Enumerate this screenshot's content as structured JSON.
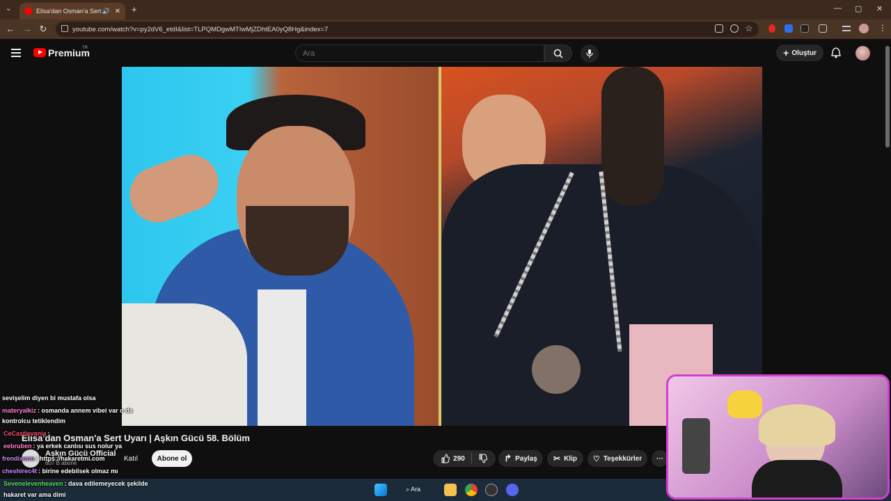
{
  "browser": {
    "tab_title": "Elisa'dan Osman'a Sert Uya",
    "url": "youtube.com/watch?v=py2dV6_etdI&list=TLPQMDgwMTIwMjZDhtEA0yQ8Hg&index=7",
    "back": "←",
    "forward": "→",
    "reload": "↻",
    "new_tab": "+",
    "minimize": "—",
    "maximize": "▢",
    "close": "✕",
    "tab_close": "✕",
    "tab_list": "⌄"
  },
  "youtube": {
    "premium_label": "Premium",
    "region": "TR",
    "search_placeholder": "Ara",
    "create_label": "Oluştur"
  },
  "video": {
    "title": "Elisa'dan Osman'a Sert Uyarı | Aşkın Gücü 58. Bölüm",
    "channel_name": "Aşkın Gücü Official",
    "channel_subs": "807 B abone",
    "join_label": "Katıl",
    "subscribe_label": "Abone ol",
    "like_count": "290",
    "share_label": "Paylaş",
    "clip_label": "Klip",
    "thanks_label": "Teşekkürler",
    "more_label": "···"
  },
  "chat": [
    {
      "user": "",
      "text": "sevişelim diyen bi mustafa olsa",
      "color": "#ffffff"
    },
    {
      "user": "materyalkiz",
      "text": ": osmanda annem vibei var o da",
      "color": "#ff7fd0"
    },
    {
      "user": "",
      "text": "kontrolcu tetiklendim",
      "color": "#ffffff"
    },
    {
      "user": "CeCastlevania",
      "text": ":",
      "color": "#ff4b6e"
    },
    {
      "user": "eebruben",
      "text": ": ya erkek canlısı sus nolur ya",
      "color": "#ff7fd0"
    },
    {
      "user": "frendixonn",
      "text": ": https://hakaretmi.com",
      "color": "#c58bff"
    },
    {
      "user": "cheshirec4t",
      "text": ": birine edebilsek olmaz mı",
      "color": "#c58bff"
    },
    {
      "user": "Sevenelevenheaven",
      "text": ": dava edilemeyecek şekilde",
      "color": "#5ddf5d"
    },
    {
      "user": "",
      "text": "hakaret var ama dimi",
      "color": "#ffffff"
    }
  ],
  "taskbar": {
    "search_label": "Ara"
  },
  "colors": {
    "accent_red": "#ff0000",
    "webcam_border": "#d23fd1",
    "browser_bg": "#3c2a1e"
  }
}
